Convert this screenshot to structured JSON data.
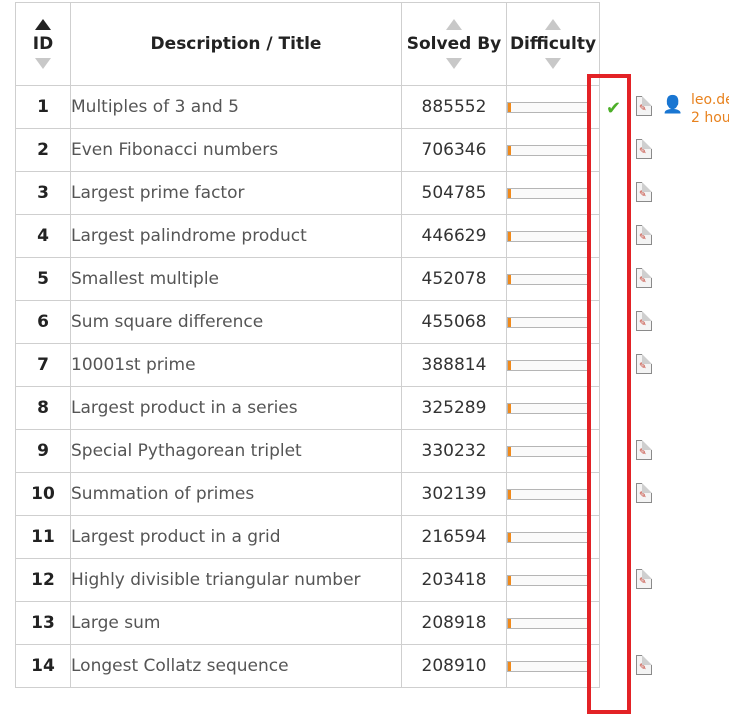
{
  "header": {
    "id": "ID",
    "title": "Description / Title",
    "solved": "Solved By",
    "difficulty": "Difficulty"
  },
  "rows": [
    {
      "id": "1",
      "title": "Multiples of 3 and 5",
      "solved": "885552",
      "difficulty": 0.03
    },
    {
      "id": "2",
      "title": "Even Fibonacci numbers",
      "solved": "706346",
      "difficulty": 0.03
    },
    {
      "id": "3",
      "title": "Largest prime factor",
      "solved": "504785",
      "difficulty": 0.03
    },
    {
      "id": "4",
      "title": "Largest palindrome product",
      "solved": "446629",
      "difficulty": 0.03
    },
    {
      "id": "5",
      "title": "Smallest multiple",
      "solved": "452078",
      "difficulty": 0.03
    },
    {
      "id": "6",
      "title": "Sum square difference",
      "solved": "455068",
      "difficulty": 0.03
    },
    {
      "id": "7",
      "title": "10001st prime",
      "solved": "388814",
      "difficulty": 0.03
    },
    {
      "id": "8",
      "title": "Largest product in a series",
      "solved": "325289",
      "difficulty": 0.03
    },
    {
      "id": "9",
      "title": "Special Pythagorean triplet",
      "solved": "330232",
      "difficulty": 0.03
    },
    {
      "id": "10",
      "title": "Summation of primes",
      "solved": "302139",
      "difficulty": 0.03
    },
    {
      "id": "11",
      "title": "Largest product in a grid",
      "solved": "216594",
      "difficulty": 0.03
    },
    {
      "id": "12",
      "title": "Highly divisible triangular number",
      "solved": "203418",
      "difficulty": 0.03
    },
    {
      "id": "13",
      "title": "Large sum",
      "solved": "208918",
      "difficulty": 0.03
    },
    {
      "id": "14",
      "title": "Longest Collatz sequence",
      "solved": "208910",
      "difficulty": 0.03
    }
  ],
  "extras": {
    "check_icon": "check-icon",
    "pdf_icon": "pdf-icon",
    "user_icon": "user-icon",
    "user_name": "leo.de",
    "user_time": "2 hou",
    "pdf_rows": [
      1,
      2,
      3,
      4,
      5,
      6,
      7,
      9,
      10,
      12,
      14
    ],
    "accent_color": "#e8821e",
    "highlight_color": "#e32226"
  }
}
